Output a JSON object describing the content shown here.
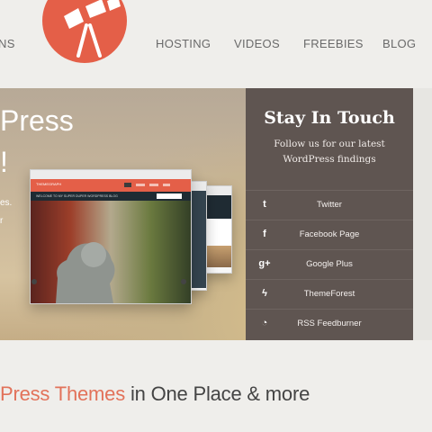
{
  "nav": {
    "left_fragment": "NS",
    "items": [
      "HOSTING",
      "VIDEOS",
      "FREEBIES",
      "BLOG"
    ]
  },
  "hero": {
    "title_fragment": "Press",
    "exclaim": "!",
    "text_fragment_1": "es.",
    "text_fragment_2": "r",
    "browser_brand": "THEMEGRAPH",
    "browser_caption": "WELCOME TO MY SUPER DUPER WORDPRESS BLOG"
  },
  "panel": {
    "title": "Stay In Touch",
    "subtitle": "Follow us for our latest WordPress findings",
    "links": [
      {
        "icon": "twitter-icon",
        "glyph": "t",
        "label": "Twitter"
      },
      {
        "icon": "facebook-icon",
        "glyph": "f",
        "label": "Facebook Page"
      },
      {
        "icon": "google-plus-icon",
        "glyph": "g+",
        "label": "Google Plus"
      },
      {
        "icon": "themeforest-icon",
        "glyph": "ϟ",
        "label": "ThemeForest"
      },
      {
        "icon": "rss-icon",
        "glyph": "◔",
        "label": "RSS Feedburner"
      }
    ]
  },
  "tagline": {
    "accent": "Press Themes",
    "rest": " in One Place & more"
  },
  "colors": {
    "accent": "#e45f48",
    "panel": "#5f5551",
    "background": "#efeeeb"
  }
}
